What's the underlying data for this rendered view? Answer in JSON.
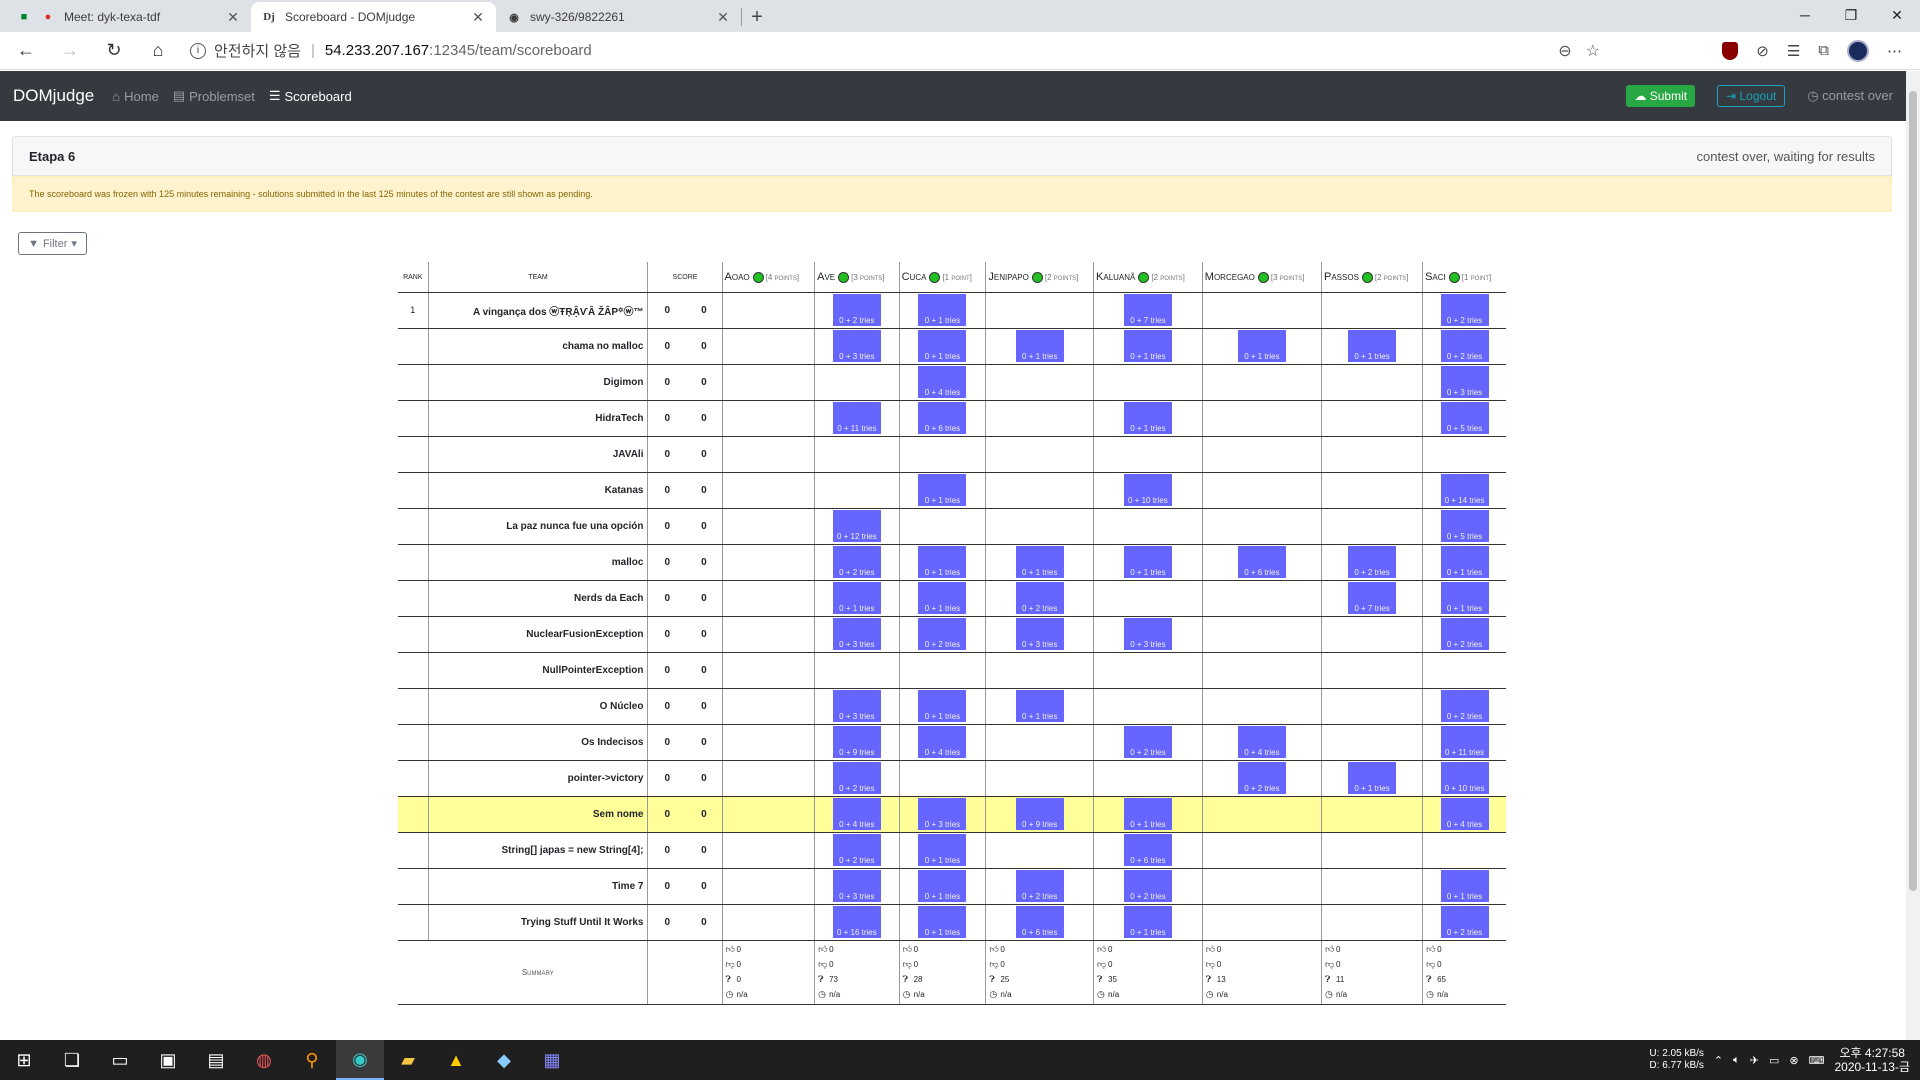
{
  "browser": {
    "tabs": [
      {
        "title": "Meet: dyk-texa-tdf",
        "icon": "meet-icon"
      },
      {
        "title": "Scoreboard - DOMjudge",
        "icon": "domjudge-icon"
      },
      {
        "title": "swy-326/9822261",
        "icon": "github-icon"
      }
    ],
    "address": {
      "security": "안전하지 않음",
      "host": "54.233.207.167",
      "path": ":12345/team/scoreboard"
    }
  },
  "nav": {
    "brand": "DOMjudge",
    "home": "Home",
    "problemset": "Problemset",
    "scoreboard": "Scoreboard",
    "submit": "Submit",
    "logout": "Logout",
    "status": "contest over"
  },
  "card": {
    "title": "Etapa 6",
    "state": "contest over, waiting for results"
  },
  "alert": "The scoreboard was frozen with 125 minutes remaining - solutions submitted in the last 125 minutes of the contest are still shown as pending.",
  "filter": "Filter",
  "scoreboard": {
    "headers": {
      "rank": "rank",
      "team": "team",
      "score": "score"
    },
    "problems": [
      {
        "name": "Aoao",
        "points": "[4 points]"
      },
      {
        "name": "Ave",
        "points": "[3 points]"
      },
      {
        "name": "Cuca",
        "points": "[1 point]"
      },
      {
        "name": "Jenipapo",
        "points": "[2 points]"
      },
      {
        "name": "Kaluanã",
        "points": "[2 points]"
      },
      {
        "name": "Morcegao",
        "points": "[3 points]"
      },
      {
        "name": "Passos",
        "points": "[2 points]"
      },
      {
        "name": "Saci",
        "points": "[1 point]"
      }
    ],
    "rows": [
      {
        "rank": "1",
        "team": "A vingança dos ⓦŦŖẬѴÂ ŽÂP꙳ⓦ™",
        "score": "0",
        "penalty": "0",
        "cells": [
          "",
          "0 + 2 tries",
          "0 + 1 tries",
          "",
          "0 + 7 tries",
          "",
          "",
          "0 + 2 tries"
        ]
      },
      {
        "rank": "",
        "team": "chama no malloc",
        "score": "0",
        "penalty": "0",
        "cells": [
          "",
          "0 + 3 tries",
          "0 + 1 tries",
          "0 + 1 tries",
          "0 + 1 tries",
          "0 + 1 tries",
          "0 + 1 tries",
          "0 + 2 tries"
        ]
      },
      {
        "rank": "",
        "team": "Digimon",
        "score": "0",
        "penalty": "0",
        "cells": [
          "",
          "",
          "0 + 4 tries",
          "",
          "",
          "",
          "",
          "0 + 3 tries"
        ]
      },
      {
        "rank": "",
        "team": "HidraTech",
        "score": "0",
        "penalty": "0",
        "cells": [
          "",
          "0 + 11 tries",
          "0 + 6 tries",
          "",
          "0 + 1 tries",
          "",
          "",
          "0 + 5 tries"
        ]
      },
      {
        "rank": "",
        "team": "JAVAli",
        "score": "0",
        "penalty": "0",
        "cells": [
          "",
          "",
          "",
          "",
          "",
          "",
          "",
          ""
        ]
      },
      {
        "rank": "",
        "team": "Katanas",
        "score": "0",
        "penalty": "0",
        "cells": [
          "",
          "",
          "0 + 1 tries",
          "",
          "0 + 10 tries",
          "",
          "",
          "0 + 14 tries"
        ]
      },
      {
        "rank": "",
        "team": "La paz nunca fue una opción",
        "score": "0",
        "penalty": "0",
        "cells": [
          "",
          "0 + 12 tries",
          "",
          "",
          "",
          "",
          "",
          "0 + 5 tries"
        ]
      },
      {
        "rank": "",
        "team": "malloc",
        "score": "0",
        "penalty": "0",
        "cells": [
          "",
          "0 + 2 tries",
          "0 + 1 tries",
          "0 + 1 tries",
          "0 + 1 tries",
          "0 + 6 tries",
          "0 + 2 tries",
          "0 + 1 tries"
        ]
      },
      {
        "rank": "",
        "team": "Nerds da Each",
        "score": "0",
        "penalty": "0",
        "cells": [
          "",
          "0 + 1 tries",
          "0 + 1 tries",
          "0 + 2 tries",
          "",
          "",
          "0 + 7 tries",
          "0 + 1 tries"
        ]
      },
      {
        "rank": "",
        "team": "NuclearFusionException",
        "score": "0",
        "penalty": "0",
        "cells": [
          "",
          "0 + 3 tries",
          "0 + 2 tries",
          "0 + 3 tries",
          "0 + 3 tries",
          "",
          "",
          "0 + 2 tries"
        ]
      },
      {
        "rank": "",
        "team": "NullPointerException",
        "score": "0",
        "penalty": "0",
        "cells": [
          "",
          "",
          "",
          "",
          "",
          "",
          "",
          ""
        ]
      },
      {
        "rank": "",
        "team": "O Núcleo",
        "score": "0",
        "penalty": "0",
        "cells": [
          "",
          "0 + 3 tries",
          "0 + 1 tries",
          "0 + 1 tries",
          "",
          "",
          "",
          "0 + 2 tries"
        ]
      },
      {
        "rank": "",
        "team": "Os Indecisos",
        "score": "0",
        "penalty": "0",
        "cells": [
          "",
          "0 + 9 tries",
          "0 + 4 tries",
          "",
          "0 + 2 tries",
          "0 + 4 tries",
          "",
          "0 + 11 tries"
        ]
      },
      {
        "rank": "",
        "team": "pointer->victory",
        "score": "0",
        "penalty": "0",
        "cells": [
          "",
          "0 + 2 tries",
          "",
          "",
          "",
          "0 + 2 tries",
          "0 + 1 tries",
          "0 + 10 tries"
        ]
      },
      {
        "rank": "",
        "team": "Sem nome",
        "score": "0",
        "penalty": "0",
        "highlight": true,
        "cells": [
          "",
          "0 + 4 tries",
          "0 + 3 tries",
          "0 + 9 tries",
          "0 + 1 tries",
          "",
          "",
          "0 + 4 tries"
        ]
      },
      {
        "rank": "",
        "team": "String[] japas = new String[4];",
        "score": "0",
        "penalty": "0",
        "cells": [
          "",
          "0 + 2 tries",
          "0 + 1 tries",
          "",
          "0 + 6 tries",
          "",
          "",
          ""
        ]
      },
      {
        "rank": "",
        "team": "Time 7",
        "score": "0",
        "penalty": "0",
        "cells": [
          "",
          "0 + 3 tries",
          "0 + 1 tries",
          "0 + 2 tries",
          "0 + 2 tries",
          "",
          "",
          "0 + 1 tries"
        ]
      },
      {
        "rank": "",
        "team": "Trying Stuff Until It Works",
        "score": "0",
        "penalty": "0",
        "cells": [
          "",
          "0 + 16 tries",
          "0 + 1 tries",
          "0 + 6 tries",
          "0 + 1 tries",
          "",
          "",
          "0 + 2 tries"
        ]
      }
    ],
    "summary_label": "Summary",
    "summary": [
      {
        "up": "0",
        "down": "0",
        "q": "0",
        "time": "n/a"
      },
      {
        "up": "0",
        "down": "0",
        "q": "73",
        "time": "n/a"
      },
      {
        "up": "0",
        "down": "0",
        "q": "28",
        "time": "n/a"
      },
      {
        "up": "0",
        "down": "0",
        "q": "25",
        "time": "n/a"
      },
      {
        "up": "0",
        "down": "0",
        "q": "35",
        "time": "n/a"
      },
      {
        "up": "0",
        "down": "0",
        "q": "13",
        "time": "n/a"
      },
      {
        "up": "0",
        "down": "0",
        "q": "11",
        "time": "n/a"
      },
      {
        "up": "0",
        "down": "0",
        "q": "65",
        "time": "n/a"
      }
    ]
  },
  "taskbar": {
    "net_up": "2.05 kB/s",
    "net_down": "6.77 kB/s",
    "net_u": "U:",
    "net_d": "D:",
    "time": "오후 4:27:58",
    "date": "2020-11-13-금"
  }
}
